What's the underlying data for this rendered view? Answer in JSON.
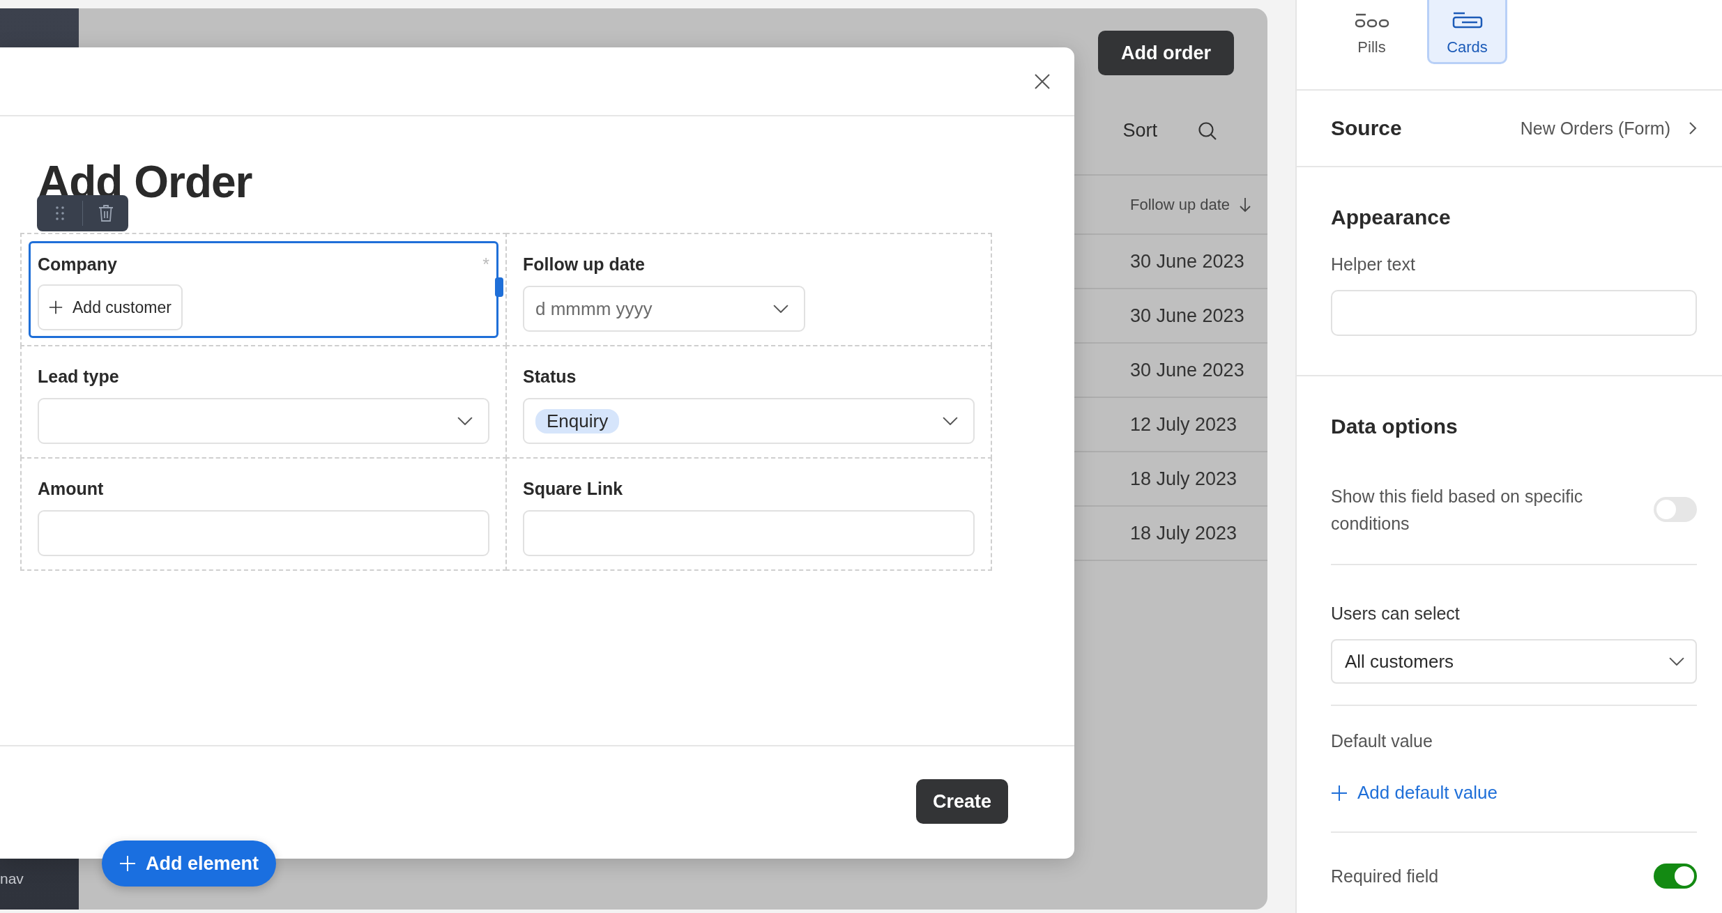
{
  "sidebar": {
    "footer_label": "nav"
  },
  "page": {
    "primary_button": "Add order",
    "sort_label": "Sort"
  },
  "table": {
    "column": {
      "label": "Follow up date",
      "sort_descending": true
    },
    "rows": [
      {
        "follow_up_date": "30 June 2023"
      },
      {
        "follow_up_date": "30 June 2023"
      },
      {
        "follow_up_date": "30 June 2023"
      },
      {
        "follow_up_date": "12 July 2023"
      },
      {
        "follow_up_date": "18 July 2023"
      },
      {
        "follow_up_date": "18 July 2023"
      }
    ]
  },
  "modal": {
    "title": "Add Order",
    "fields": [
      {
        "label": "Company",
        "kind": "customer",
        "selected": true,
        "required_mark": "*",
        "button": "Add customer"
      },
      {
        "label": "Follow up date",
        "kind": "date",
        "selected": false,
        "placeholder": "d mmmm yyyy"
      },
      {
        "label": "Lead type",
        "kind": "select",
        "selected": false
      },
      {
        "label": "Status",
        "kind": "select",
        "selected": false,
        "value_tag": "Enquiry"
      },
      {
        "label": "Amount",
        "kind": "text",
        "selected": false
      },
      {
        "label": "Square Link",
        "kind": "text",
        "selected": false
      }
    ],
    "primary_button": "Create"
  },
  "add_element_button": "Add element",
  "properties": {
    "display_options": [
      {
        "label": "Pills",
        "kind": "pills",
        "selected": false
      },
      {
        "label": "Cards",
        "kind": "cards",
        "selected": true
      }
    ],
    "source": {
      "label": "Source",
      "value": "New Orders (Form)"
    },
    "appearance": {
      "heading": "Appearance",
      "helper_text_label": "Helper text"
    },
    "data_options": {
      "heading": "Data options",
      "conditional": {
        "label": "Show this field based on specific conditions",
        "on": false
      },
      "users_can_select": {
        "label": "Users can select",
        "value": "All customers"
      },
      "default_value": {
        "label": "Default value",
        "link": "Add default value"
      },
      "required": {
        "label": "Required field",
        "on": true
      }
    }
  }
}
